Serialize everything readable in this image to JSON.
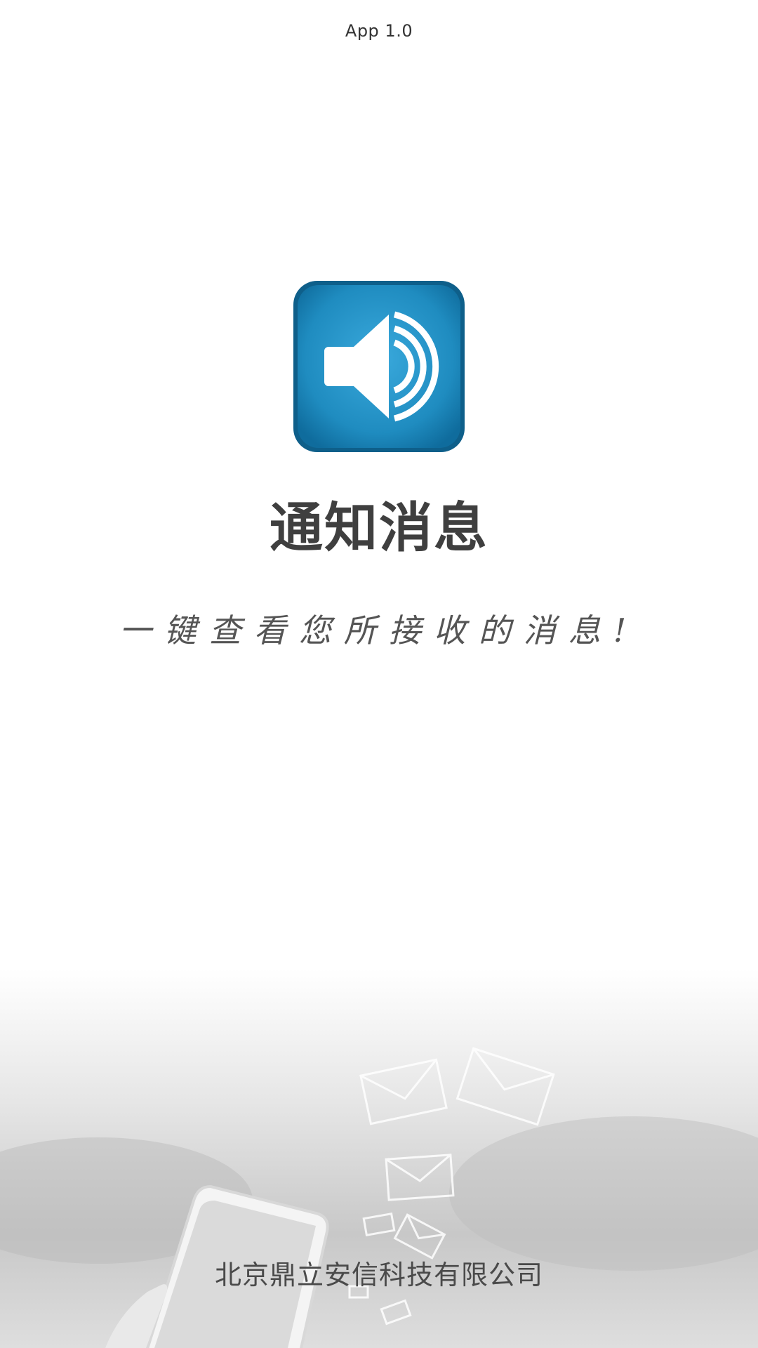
{
  "version_label": "App 1.0",
  "app": {
    "title": "通知消息",
    "slogan": "一键查看您所接收的消息!",
    "icon": "speaker-icon"
  },
  "footer": {
    "company": "北京鼎立安信科技有限公司"
  },
  "colors": {
    "icon_bg": "#1e86b8",
    "icon_bg_light": "#2e9fd3",
    "icon_border": "#0e5f8a",
    "text_dark": "#3f3f3f"
  }
}
